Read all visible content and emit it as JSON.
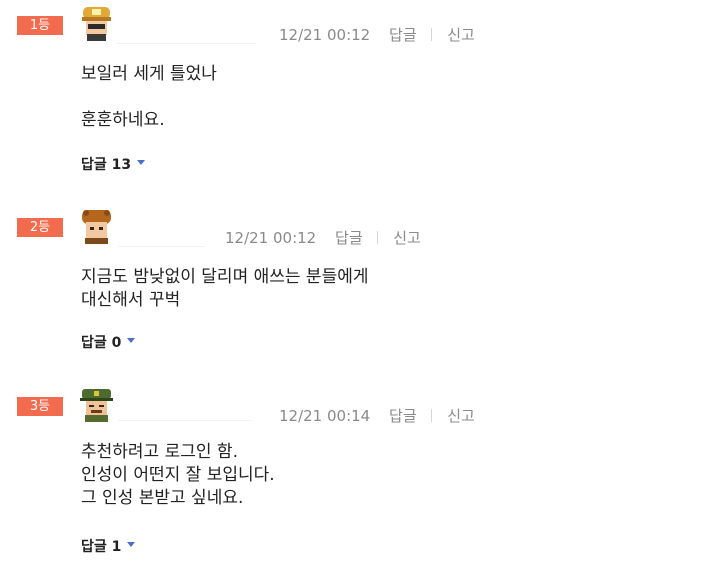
{
  "comments": [
    {
      "rank": "1등",
      "time": "12/21 00:12",
      "reply": "답글",
      "report": "신고",
      "lines": "보일러 세게 틀었나\n\n훈훈하네요.",
      "replies_label": "답글",
      "replies_count": "13",
      "avatar": "miner-helmet-avatar-icon"
    },
    {
      "rank": "2등",
      "time": "12/21 00:12",
      "reply": "답글",
      "report": "신고",
      "lines": "지금도 밤낮없이 달리며 애쓰는 분들에게\n대신해서 꾸벅",
      "replies_label": "답글",
      "replies_count": "0",
      "avatar": "bear-hood-avatar-icon"
    },
    {
      "rank": "3등",
      "time": "12/21 00:14",
      "reply": "답글",
      "report": "신고",
      "lines": "추천하려고 로그인 함.\n인성이 어떤지 잘 보입니다.\n그 인성 본받고 싶네요.",
      "replies_label": "답글",
      "replies_count": "1",
      "avatar": "soldier-cap-avatar-icon"
    }
  ],
  "colors": {
    "rank_badge": "#f26b4f",
    "caret": "#4a6fc6",
    "meta": "#8a8a8a"
  }
}
